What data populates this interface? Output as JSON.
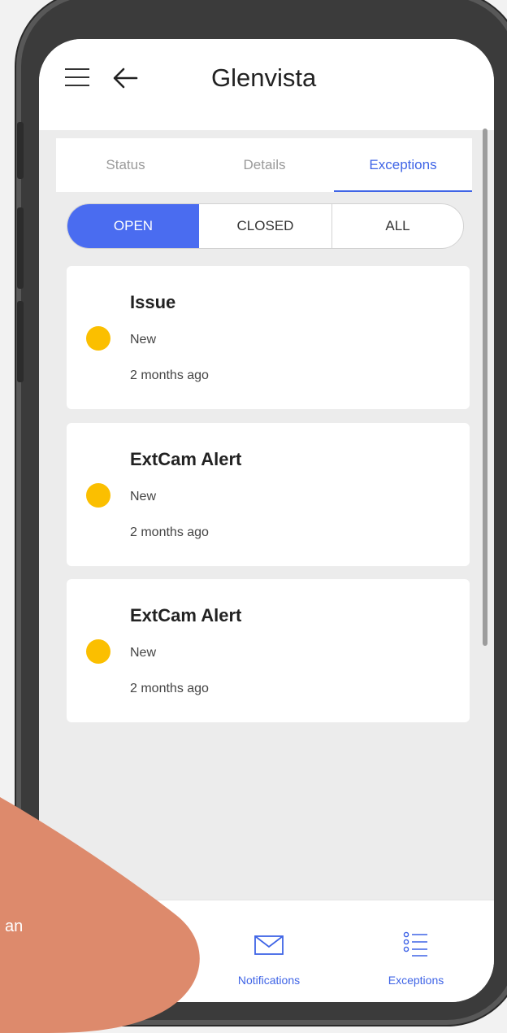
{
  "app": {
    "title": "Glenvista"
  },
  "tabs": [
    {
      "label": "Status",
      "active": false
    },
    {
      "label": "Details",
      "active": false
    },
    {
      "label": "Exceptions",
      "active": true
    }
  ],
  "filter": {
    "options": [
      "OPEN",
      "CLOSED",
      "ALL"
    ],
    "selected": "OPEN"
  },
  "exceptions": [
    {
      "title": "Issue",
      "status": "New",
      "time": "2 months ago",
      "dot_color": "#fbbf00"
    },
    {
      "title": "ExtCam Alert",
      "status": "New",
      "time": "2 months ago",
      "dot_color": "#fbbf00"
    },
    {
      "title": "ExtCam Alert",
      "status": "New",
      "time": "2 months ago",
      "dot_color": "#fbbf00"
    }
  ],
  "bottom_nav": [
    {
      "label": "Notifications",
      "icon": "mail-icon"
    },
    {
      "label": "Exceptions",
      "icon": "list-icon"
    }
  ],
  "overlay": {
    "text": "an",
    "color": "#dd8a6c"
  },
  "colors": {
    "accent": "#3f64e6",
    "segment_active": "#4a6cf0",
    "background": "#ececec"
  }
}
